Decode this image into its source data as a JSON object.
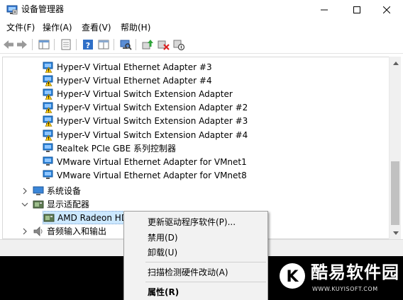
{
  "window": {
    "title": "设备管理器"
  },
  "menubar": {
    "items": [
      "文件(F)",
      "操作(A)",
      "查看(V)",
      "帮助(H)"
    ]
  },
  "toolbar": {
    "icons": [
      "back-icon",
      "forward-icon",
      "show-hide-tree-icon",
      "properties-icon",
      "help-icon",
      "console-tree-icon",
      "scan-hardware-icon",
      "update-driver-icon",
      "uninstall-device-icon",
      "disable-device-icon"
    ]
  },
  "tree": {
    "network_adapters": [
      {
        "label": "Hyper-V Virtual Ethernet Adapter #3",
        "warning": true
      },
      {
        "label": "Hyper-V Virtual Ethernet Adapter #4",
        "warning": true
      },
      {
        "label": "Hyper-V Virtual Switch Extension Adapter",
        "warning": true
      },
      {
        "label": "Hyper-V Virtual Switch Extension Adapter #2",
        "warning": true
      },
      {
        "label": "Hyper-V Virtual Switch Extension Adapter #3",
        "warning": true
      },
      {
        "label": "Hyper-V Virtual Switch Extension Adapter #4",
        "warning": true
      },
      {
        "label": "Realtek PCIe GBE 系列控制器",
        "warning": false
      },
      {
        "label": "VMware Virtual Ethernet Adapter for VMnet1",
        "warning": false
      },
      {
        "label": "VMware Virtual Ethernet Adapter for VMnet8",
        "warning": false
      }
    ],
    "system_devices": "系统设备",
    "display_adapters": "显示适配器",
    "display_child": "AMD Radeon HD",
    "audio": "音频输入和输出"
  },
  "context_menu": {
    "update_driver": "更新驱动程序软件(P)...",
    "disable": "禁用(D)",
    "uninstall": "卸载(U)",
    "scan": "扫描检测硬件改动(A)",
    "properties": "属性(R)"
  },
  "watermark": {
    "brand": "酷易软件园",
    "url": "WWW.KUYISOFT.COM",
    "letter": "K"
  },
  "colors": {
    "accent": "#0078d7",
    "selection": "#cce8ff",
    "menu_bg": "#f2f2f2",
    "warning": "#f5c400"
  }
}
